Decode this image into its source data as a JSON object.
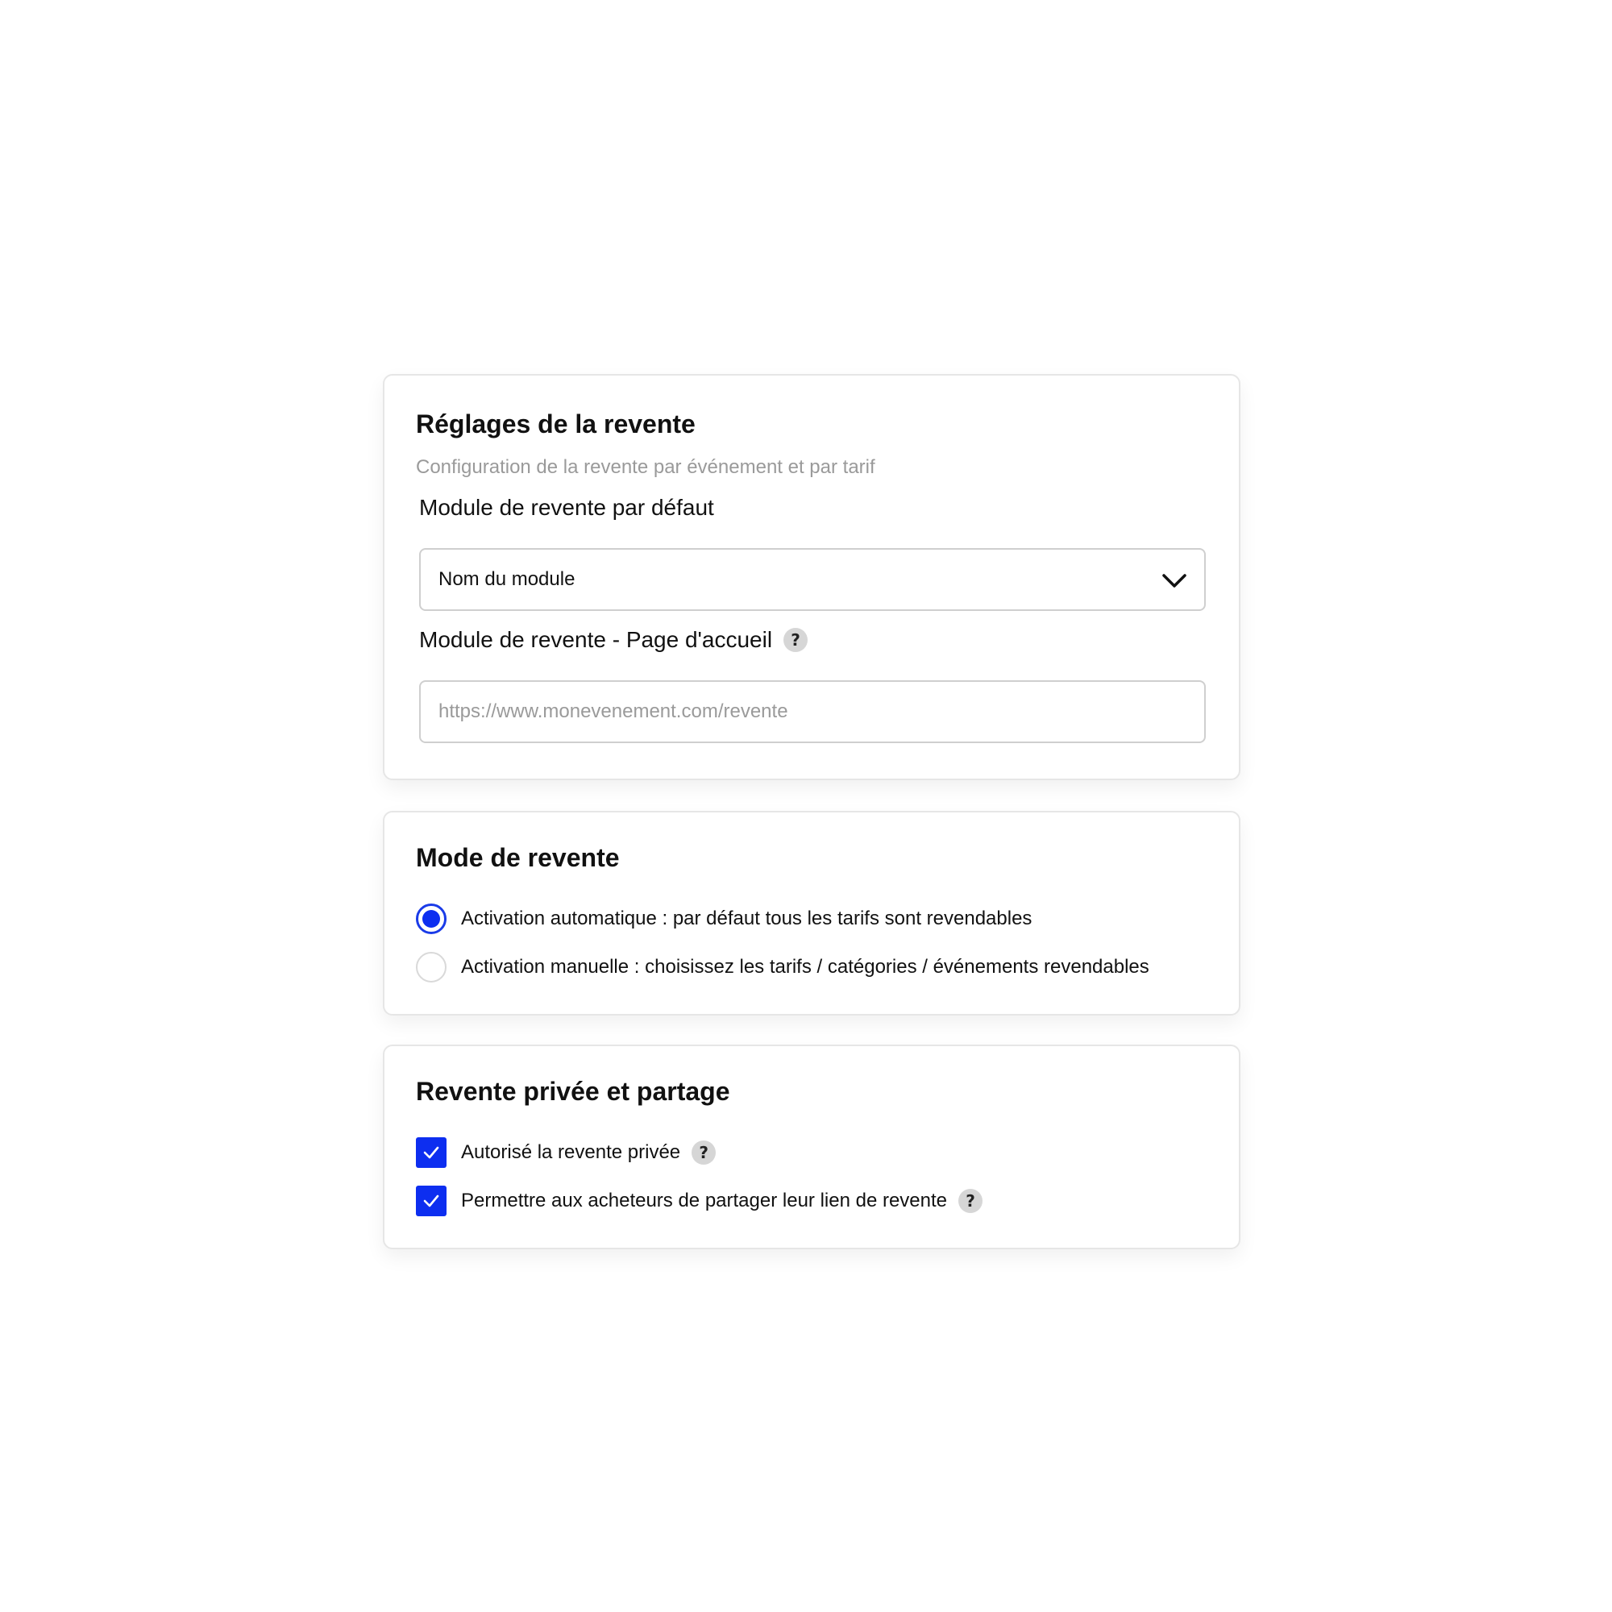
{
  "settings_card": {
    "title": "Réglages de la revente",
    "subtitle": "Configuration de la revente par événement et par tarif",
    "default_module": {
      "label": "Module de revente par défaut",
      "selected_value": "Nom du module",
      "icon": "chevron-down-icon"
    },
    "homepage_module": {
      "label": "Module de revente - Page d'accueil",
      "help_icon_text": "?",
      "placeholder": "https://www.monevenement.com/revente",
      "value": ""
    }
  },
  "mode_card": {
    "title": "Mode de revente",
    "options": [
      {
        "label": "Activation automatique : par défaut tous les tarifs sont revendables",
        "selected": true
      },
      {
        "label": "Activation manuelle : choisissez les tarifs / catégories / événements revendables",
        "selected": false
      }
    ]
  },
  "private_card": {
    "title": "Revente privée et partage",
    "options": [
      {
        "label": "Autorisé la revente privée",
        "checked": true,
        "help_icon_text": "?"
      },
      {
        "label": "Permettre aux acheteurs de partager leur lien de revente",
        "checked": true,
        "help_icon_text": "?"
      }
    ]
  },
  "colors": {
    "accent": "#0d2ef0",
    "border": "#e6e6e6",
    "muted_text": "#9a9a9a",
    "help_icon_bg": "#d6d6d6"
  }
}
